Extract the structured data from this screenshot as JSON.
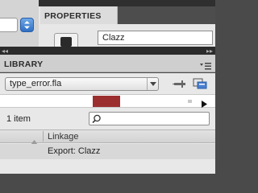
{
  "stage_area": {
    "stepper_icon": "stepper-arrows-icon"
  },
  "properties_panel": {
    "tab_label": "PROPERTIES",
    "symbol_icon": "movieclip-symbol-icon",
    "instance_name": "Clazz"
  },
  "library_panel": {
    "title": "LIBRARY",
    "document_select": {
      "selected": "type_error.fla"
    },
    "preview": {
      "swatch_color": "#9b2f2f"
    },
    "item_count": "1 item",
    "search": {
      "placeholder": "",
      "value": ""
    },
    "columns": {
      "linkage": "Linkage"
    },
    "items": [
      {
        "linkage": "Export: Clazz"
      }
    ]
  },
  "colors": {
    "panel_bg": "#e8e8e8",
    "header_bg": "#cfcfcf",
    "dark_chrome": "#2b2b2b",
    "accent_blue": "#2f6fc4"
  }
}
